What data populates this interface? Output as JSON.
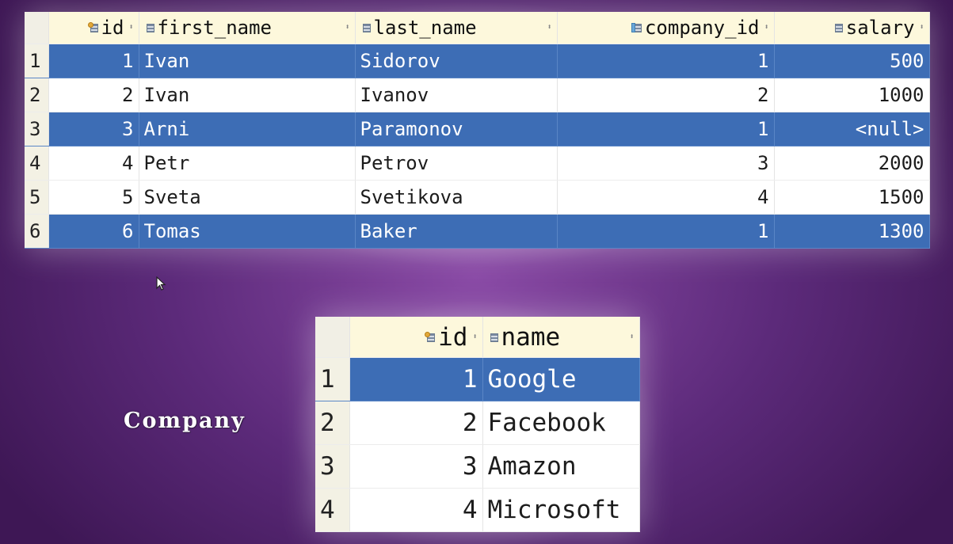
{
  "employee_table": {
    "columns": [
      {
        "label": "id",
        "icon": "primary-key-column-icon",
        "align": "right"
      },
      {
        "label": "first_name",
        "icon": "column-icon",
        "align": "left"
      },
      {
        "label": "last_name",
        "icon": "column-icon",
        "align": "left"
      },
      {
        "label": "company_id",
        "icon": "foreign-key-column-icon",
        "align": "right"
      },
      {
        "label": "salary",
        "icon": "column-icon",
        "align": "right"
      }
    ],
    "rows": [
      {
        "num": "1",
        "selected": true,
        "cells": [
          "1",
          "Ivan",
          "Sidorov",
          "1",
          "500"
        ]
      },
      {
        "num": "2",
        "selected": false,
        "cells": [
          "2",
          "Ivan",
          "Ivanov",
          "2",
          "1000"
        ]
      },
      {
        "num": "3",
        "selected": true,
        "cells": [
          "3",
          "Arni",
          "Paramonov",
          "1",
          "<null>"
        ]
      },
      {
        "num": "4",
        "selected": false,
        "cells": [
          "4",
          "Petr",
          "Petrov",
          "3",
          "2000"
        ]
      },
      {
        "num": "5",
        "selected": false,
        "cells": [
          "5",
          "Sveta",
          "Svetikova",
          "4",
          "1500"
        ]
      },
      {
        "num": "6",
        "selected": true,
        "cells": [
          "6",
          "Tomas",
          "Baker",
          "1",
          "1300"
        ]
      }
    ]
  },
  "company_caption": "Company",
  "company_table": {
    "columns": [
      {
        "label": "id",
        "icon": "primary-key-column-icon",
        "align": "right"
      },
      {
        "label": "name",
        "icon": "column-icon",
        "align": "left"
      }
    ],
    "rows": [
      {
        "num": "1",
        "selected": true,
        "cells": [
          "1",
          "Google"
        ]
      },
      {
        "num": "2",
        "selected": false,
        "cells": [
          "2",
          "Facebook"
        ]
      },
      {
        "num": "3",
        "selected": false,
        "cells": [
          "3",
          "Amazon"
        ]
      },
      {
        "num": "4",
        "selected": false,
        "cells": [
          "4",
          "Microsoft"
        ]
      }
    ]
  },
  "sort_glyph": "⬍",
  "colors": {
    "selection": "#3d6db5",
    "header_bg": "#fdf8dc",
    "background": "#5c2a7a"
  }
}
